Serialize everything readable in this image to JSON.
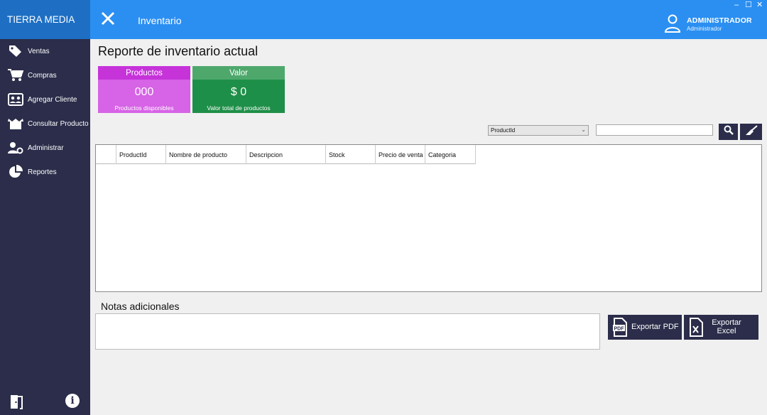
{
  "sidebar": {
    "brand": "TIERRA MEDIA",
    "items": [
      {
        "label": "Ventas",
        "icon": "tag-icon"
      },
      {
        "label": "Compras",
        "icon": "cart-icon"
      },
      {
        "label": "Agregar Cliente",
        "icon": "contacts-icon"
      },
      {
        "label": "Consultar Producto",
        "icon": "box-icon"
      },
      {
        "label": "Administrar",
        "icon": "user-gear-icon"
      },
      {
        "label": "Reportes",
        "icon": "pie-chart-icon"
      }
    ]
  },
  "header": {
    "title": "Inventario",
    "user_name": "ADMINISTRADOR",
    "user_role": "Administrador"
  },
  "window_controls": {
    "minimize": "–",
    "maximize": "☐",
    "close": "✕"
  },
  "page": {
    "title": "Reporte de inventario actual"
  },
  "cards": {
    "productos": {
      "title": "Productos",
      "value": "000",
      "subtitle": "Productos disponibles"
    },
    "valor": {
      "title": "Valor",
      "value": "$ 0",
      "subtitle": "Valor total de productos"
    }
  },
  "filter": {
    "selected": "ProductId",
    "search_value": ""
  },
  "grid": {
    "columns": [
      {
        "label": "ProductId",
        "width": 70
      },
      {
        "label": "Nombre de producto",
        "width": 113
      },
      {
        "label": "Descripcion",
        "width": 112
      },
      {
        "label": "Stock",
        "width": 70
      },
      {
        "label": "Precio de venta",
        "width": 70
      },
      {
        "label": "Categoria",
        "width": 71
      }
    ],
    "rows": []
  },
  "notes": {
    "label": "Notas adicionales",
    "value": ""
  },
  "export": {
    "pdf_label": "Exportar PDF",
    "excel_label": "Exportar Excel"
  },
  "colors": {
    "sidebar": "#2b2d4a",
    "brand": "#1e6fc4",
    "header": "#2b8ff2",
    "productos_card": "#d763e6",
    "valor_card": "#1e8f48"
  }
}
